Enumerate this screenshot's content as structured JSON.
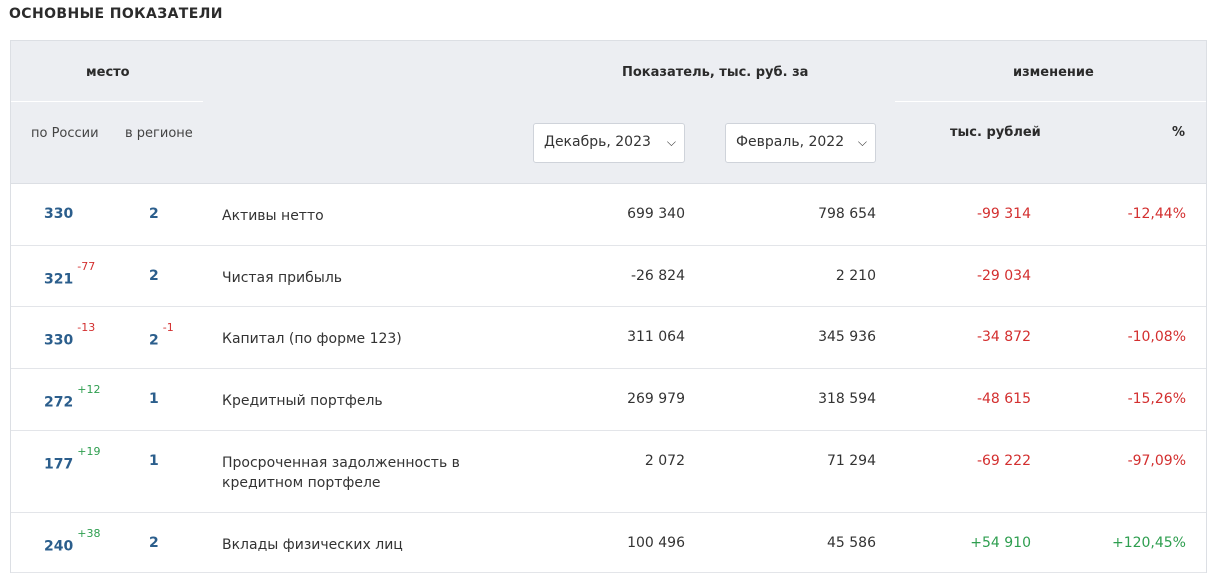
{
  "section_title": "ОСНОВНЫЕ ПОКАЗАТЕЛИ",
  "header": {
    "place": "место",
    "place_russia": "по России",
    "place_region": "в регионе",
    "indicator": "Показатель, тыс. руб. за",
    "period1": "Декабрь, 2023",
    "period2": "Февраль, 2022",
    "change": "изменение",
    "change_rub": "тыс. рублей",
    "change_pct": "%"
  },
  "rows": [
    {
      "rank": "330",
      "rank_delta": "",
      "region": "2",
      "region_delta": "",
      "name": "Активы нетто",
      "v1": "699 340",
      "v2": "798 654",
      "diff": "-99 314",
      "pct": "-12,44%"
    },
    {
      "rank": "321",
      "rank_delta": "-77",
      "region": "2",
      "region_delta": "",
      "name": "Чистая прибыль",
      "v1": "-26 824",
      "v2": "2 210",
      "diff": "-29 034",
      "pct": ""
    },
    {
      "rank": "330",
      "rank_delta": "-13",
      "region": "2",
      "region_delta": "-1",
      "name": "Капитал (по форме 123)",
      "v1": "311 064",
      "v2": "345 936",
      "diff": "-34 872",
      "pct": "-10,08%"
    },
    {
      "rank": "272",
      "rank_delta": "+12",
      "region": "1",
      "region_delta": "",
      "name": "Кредитный портфель",
      "v1": "269 979",
      "v2": "318 594",
      "diff": "-48 615",
      "pct": "-15,26%"
    },
    {
      "rank": "177",
      "rank_delta": "+19",
      "region": "1",
      "region_delta": "",
      "name": "Просроченная задолженность в кредитном портфеле",
      "v1": "2 072",
      "v2": "71 294",
      "diff": "-69 222",
      "pct": "-97,09%"
    },
    {
      "rank": "240",
      "rank_delta": "+38",
      "region": "2",
      "region_delta": "",
      "name": "Вклады физических лиц",
      "v1": "100 496",
      "v2": "45 586",
      "diff": "+54 910",
      "pct": "+120,45%"
    }
  ]
}
